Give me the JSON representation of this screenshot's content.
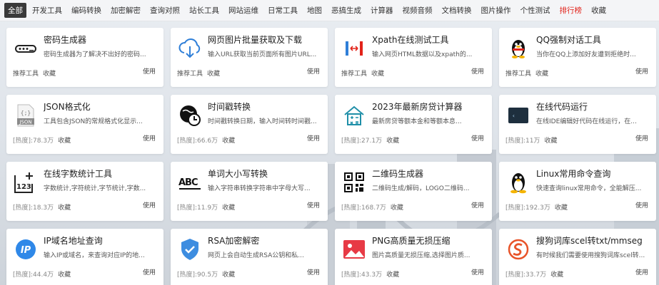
{
  "nav": {
    "items": [
      "全部",
      "开发工具",
      "编码转换",
      "加密解密",
      "查询对照",
      "站长工具",
      "网站运维",
      "日常工具",
      "地图",
      "恶搞生成",
      "计算器",
      "视频音频",
      "文档转换",
      "图片操作",
      "个性测试",
      "排行榜",
      "收藏"
    ],
    "active": "全部",
    "hot": "排行榜"
  },
  "colors": {
    "active_bg": "#3a3a3a",
    "hot": "#e2231a",
    "accent_blue": "#2f7fd8"
  },
  "common": {
    "use_label": "使用",
    "fav_label": "收藏"
  },
  "cards": [
    {
      "icon": "password-icon",
      "title": "密码生成器",
      "desc": "密码生成器为了解决不出好的密码...",
      "tag": "推荐工具"
    },
    {
      "icon": "cloud-download-icon",
      "title": "网页图片批量获取及下载",
      "desc": "输入URL获取当前页面所有图片URL...",
      "tag": "推荐工具"
    },
    {
      "icon": "xpath-icon",
      "title": "Xpath在线测试工具",
      "desc": "输入网页HTML数据以及xpath的...",
      "tag": "推荐工具"
    },
    {
      "icon": "qq-penguin-icon",
      "title": "QQ强制对话工具",
      "desc": "当你在QQ上添加好友遭到拒绝时...",
      "tag": "推荐工具"
    },
    {
      "icon": "json-file-icon",
      "title": "JSON格式化",
      "desc": "工具包含JSON的常规格式化显示...",
      "hot": "[热度]:78.3万"
    },
    {
      "icon": "clock-icon",
      "title": "时间戳转换",
      "desc": "时间戳转换日期，输入时间转时间戳...",
      "hot": "[热度]:66.6万"
    },
    {
      "icon": "house-calculator-icon",
      "title": "2023年最新房贷计算器",
      "desc": "最新房贷等额本金和等额本息...",
      "hot": "[热度]:27.1万"
    },
    {
      "icon": "code-editor-icon",
      "title": "在线代码运行",
      "desc": "在线IDE编辑好代码在线运行，在...",
      "hot": "[热度]:11万"
    },
    {
      "icon": "counter-icon",
      "title": "在线字数统计工具",
      "desc": "字数统计,字符统计,字节统计,字数...",
      "hot": "[热度]:18.3万"
    },
    {
      "icon": "abc-case-icon",
      "title": "单词大小写转换",
      "desc": "输入字符串转换字符串中字母大写...",
      "hot": "[热度]:11.9万"
    },
    {
      "icon": "qrcode-icon",
      "title": "二维码生成器",
      "desc": "二维码生成/解码，LOGO二维码...",
      "hot": "[热度]:168.7万"
    },
    {
      "icon": "linux-penguin-icon",
      "title": "Linux常用命令查询",
      "desc": "快速查询linux常用命令，全能解压...",
      "hot": "[热度]:192.3万"
    },
    {
      "icon": "ip-icon",
      "title": "IP域名地址查询",
      "desc": "输入IP或域名，来查询对应IP的地...",
      "hot": "[热度]:44.4万"
    },
    {
      "icon": "shield-icon",
      "title": "RSA加密解密",
      "desc": "网页上会自动生成RSA公钥和私...",
      "hot": "[热度]:90.5万"
    },
    {
      "icon": "image-icon",
      "title": "PNG高质量无损压缩",
      "desc": "图片高质量无损压缩,选择图片质...",
      "hot": "[热度]:43.3万"
    },
    {
      "icon": "sogou-icon",
      "title": "搜狗词库scel转txt/mmseg",
      "desc": "有时候我们需要使用搜狗词库scel转...",
      "hot": "[热度]:33.7万"
    }
  ]
}
